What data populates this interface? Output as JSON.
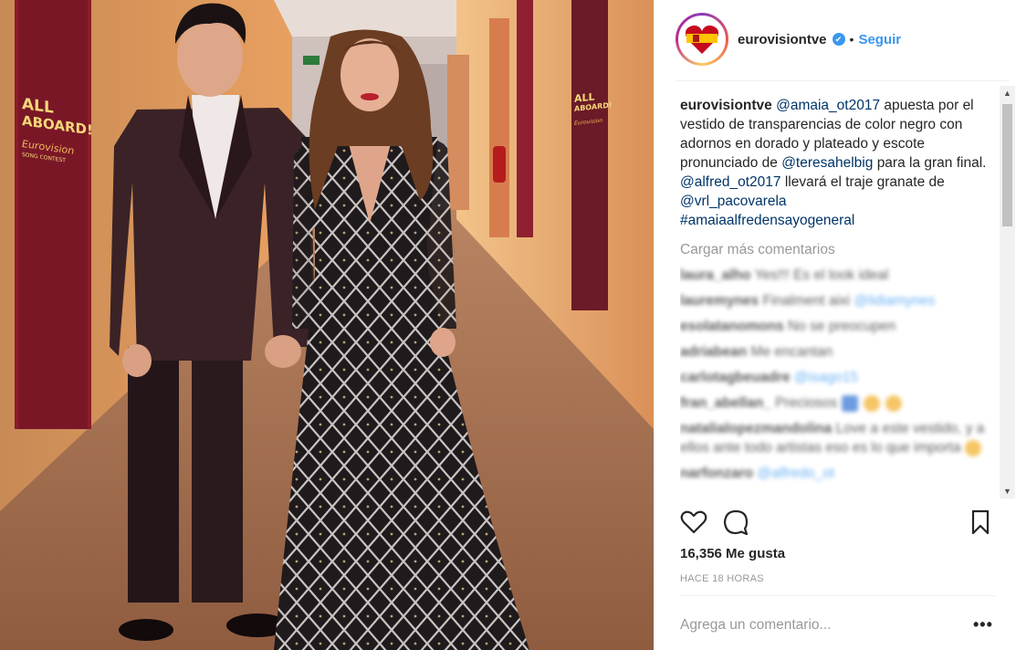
{
  "post": {
    "author": "eurovisiontve",
    "separator": "•",
    "follow_label": "Seguir",
    "verified_icon": "verified-badge-icon"
  },
  "photo": {
    "left_sign": {
      "line1": "ALL",
      "line2": "ABOARD!",
      "brand": "Eurovision",
      "sub": "SONG CONTEST"
    },
    "right_sign": {
      "line1": "ALL",
      "line2": "ABOARD!",
      "brand": "Eurovision"
    }
  },
  "caption": {
    "user": "eurovisiontve",
    "mention1": "@amaia_ot2017",
    "text1": "apuesta por el vestido de transparencias de color negro con adornos en dorado y plateado y escote pronunciado de",
    "mention2": "@teresahelbig",
    "text2": "para la gran final.",
    "mention3": "@alfred_ot2017",
    "text3": "llevará el traje granate de",
    "mention4": "@vrl_pacovarela",
    "hashtag": "#amaiaalfredensayogeneral"
  },
  "load_more": "Cargar más comentarios",
  "comments": [
    {
      "user": "laura_alho",
      "text": "Yes!!! Es el look ideal"
    },
    {
      "user": "lauremynes",
      "text": "Finalment aixi",
      "link": "@lidiamynes"
    },
    {
      "user": "esolatanomons",
      "text": "No se preocupen"
    },
    {
      "user": "adriabean",
      "text": "Me encantan"
    },
    {
      "user": "carlotagbeuadre",
      "link": "@isago15"
    },
    {
      "user": "fran_abellan_",
      "text": "Preciosos"
    },
    {
      "user": "natalialopezmandolina",
      "text": "Love a este vestido, y a ellos ante todo artistas eso es lo que importa"
    },
    {
      "user": "narfonzaro",
      "link": "@alfredo_ot"
    }
  ],
  "actions": {
    "like_icon": "heart-icon",
    "comment_icon": "comment-icon",
    "save_icon": "bookmark-icon"
  },
  "likes_text": "16,356 Me gusta",
  "time_text": "HACE 18 HORAS",
  "comment_input": {
    "placeholder": "Agrega un comentario..."
  },
  "more_options": "•••",
  "colors": {
    "link": "#003569",
    "accent": "#3897f0",
    "muted": "#999999"
  }
}
